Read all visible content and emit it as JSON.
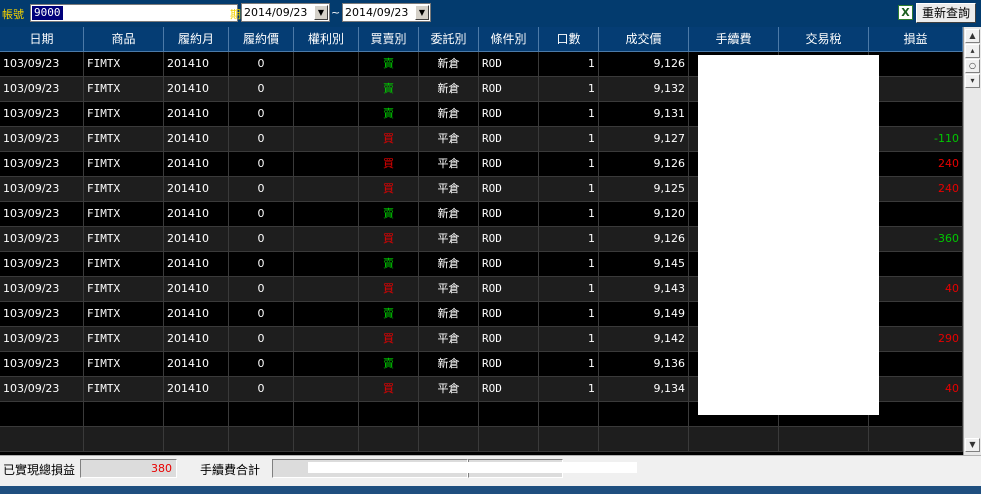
{
  "toolbar": {
    "account_label": "帳號",
    "account_value": "9000",
    "account_suffix": "期",
    "date_from": "2014/09/23",
    "date_to": "2014/09/23",
    "date_separator": "~",
    "excel_icon": "excel-export-icon",
    "requery_label": "重新查詢"
  },
  "columns": [
    "日期",
    "商品",
    "履約月",
    "履約價",
    "權利別",
    "買賣別",
    "委託別",
    "條件別",
    "口數",
    "成交價",
    "手續費",
    "交易稅",
    "損益"
  ],
  "rows": [
    {
      "date": "103/09/23",
      "product": "FIMTX",
      "month": "201410",
      "strike": "0",
      "right": "",
      "side": "賣",
      "order_type": "新倉",
      "cond": "ROD",
      "qty": "1",
      "price": "9,126",
      "fee": "",
      "tax": "",
      "pl": ""
    },
    {
      "date": "103/09/23",
      "product": "FIMTX",
      "month": "201410",
      "strike": "0",
      "right": "",
      "side": "賣",
      "order_type": "新倉",
      "cond": "ROD",
      "qty": "1",
      "price": "9,132",
      "fee": "",
      "tax": "",
      "pl": ""
    },
    {
      "date": "103/09/23",
      "product": "FIMTX",
      "month": "201410",
      "strike": "0",
      "right": "",
      "side": "賣",
      "order_type": "新倉",
      "cond": "ROD",
      "qty": "1",
      "price": "9,131",
      "fee": "",
      "tax": "",
      "pl": ""
    },
    {
      "date": "103/09/23",
      "product": "FIMTX",
      "month": "201410",
      "strike": "0",
      "right": "",
      "side": "買",
      "order_type": "平倉",
      "cond": "ROD",
      "qty": "1",
      "price": "9,127",
      "fee": "",
      "tax": "",
      "pl": "-110"
    },
    {
      "date": "103/09/23",
      "product": "FIMTX",
      "month": "201410",
      "strike": "0",
      "right": "",
      "side": "買",
      "order_type": "平倉",
      "cond": "ROD",
      "qty": "1",
      "price": "9,126",
      "fee": "",
      "tax": "",
      "pl": "240"
    },
    {
      "date": "103/09/23",
      "product": "FIMTX",
      "month": "201410",
      "strike": "0",
      "right": "",
      "side": "買",
      "order_type": "平倉",
      "cond": "ROD",
      "qty": "1",
      "price": "9,125",
      "fee": "",
      "tax": "",
      "pl": "240"
    },
    {
      "date": "103/09/23",
      "product": "FIMTX",
      "month": "201410",
      "strike": "0",
      "right": "",
      "side": "賣",
      "order_type": "新倉",
      "cond": "ROD",
      "qty": "1",
      "price": "9,120",
      "fee": "",
      "tax": "",
      "pl": ""
    },
    {
      "date": "103/09/23",
      "product": "FIMTX",
      "month": "201410",
      "strike": "0",
      "right": "",
      "side": "買",
      "order_type": "平倉",
      "cond": "ROD",
      "qty": "1",
      "price": "9,126",
      "fee": "",
      "tax": "",
      "pl": "-360"
    },
    {
      "date": "103/09/23",
      "product": "FIMTX",
      "month": "201410",
      "strike": "0",
      "right": "",
      "side": "賣",
      "order_type": "新倉",
      "cond": "ROD",
      "qty": "1",
      "price": "9,145",
      "fee": "",
      "tax": "",
      "pl": ""
    },
    {
      "date": "103/09/23",
      "product": "FIMTX",
      "month": "201410",
      "strike": "0",
      "right": "",
      "side": "買",
      "order_type": "平倉",
      "cond": "ROD",
      "qty": "1",
      "price": "9,143",
      "fee": "",
      "tax": "",
      "pl": "40"
    },
    {
      "date": "103/09/23",
      "product": "FIMTX",
      "month": "201410",
      "strike": "0",
      "right": "",
      "side": "賣",
      "order_type": "新倉",
      "cond": "ROD",
      "qty": "1",
      "price": "9,149",
      "fee": "",
      "tax": "",
      "pl": ""
    },
    {
      "date": "103/09/23",
      "product": "FIMTX",
      "month": "201410",
      "strike": "0",
      "right": "",
      "side": "買",
      "order_type": "平倉",
      "cond": "ROD",
      "qty": "1",
      "price": "9,142",
      "fee": "",
      "tax": "",
      "pl": "290"
    },
    {
      "date": "103/09/23",
      "product": "FIMTX",
      "month": "201410",
      "strike": "0",
      "right": "",
      "side": "賣",
      "order_type": "新倉",
      "cond": "ROD",
      "qty": "1",
      "price": "9,136",
      "fee": "",
      "tax": "",
      "pl": ""
    },
    {
      "date": "103/09/23",
      "product": "FIMTX",
      "month": "201410",
      "strike": "0",
      "right": "",
      "side": "買",
      "order_type": "平倉",
      "cond": "ROD",
      "qty": "1",
      "price": "9,134",
      "fee": "",
      "tax": "",
      "pl": "40"
    }
  ],
  "footer": {
    "realized_pl_label": "已實現總損益",
    "realized_pl_value": "380",
    "fee_total_label": "手續費合計",
    "fee_total_value": ""
  },
  "colors": {
    "header_bg": "#053d74",
    "buy_red": "#e80000",
    "sell_green": "#00c800",
    "row_dark": "#000000",
    "row_alt": "#1e1e1e"
  }
}
